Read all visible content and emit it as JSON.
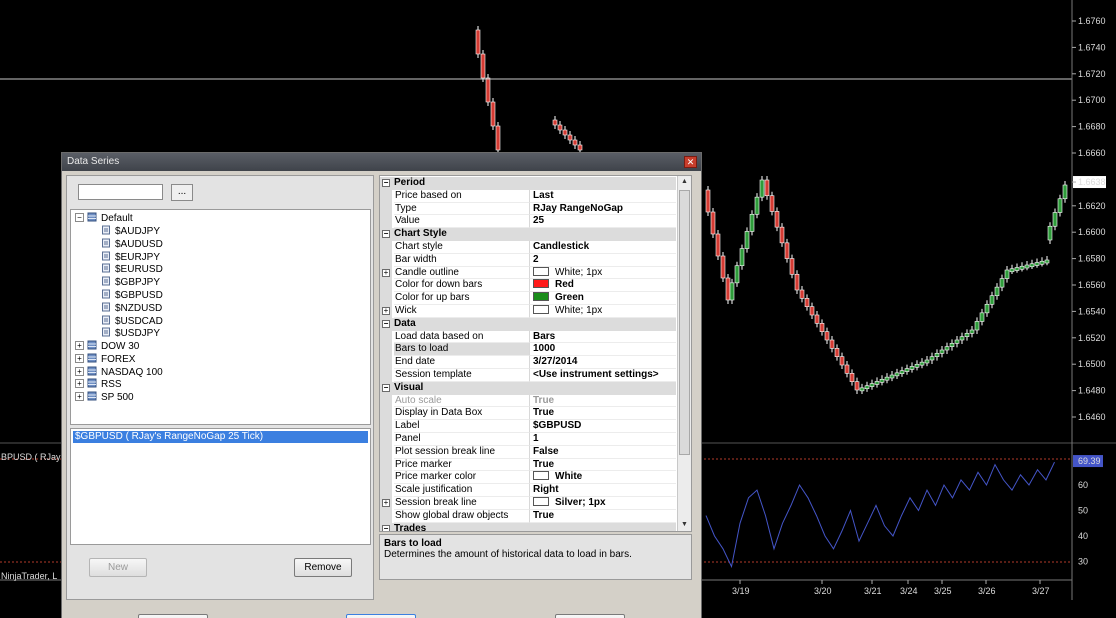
{
  "chart": {
    "price_axis": [
      "1.6760",
      "1.6740",
      "1.6720",
      "1.6700",
      "1.6680",
      "1.6660",
      "1.6638",
      "1.6620",
      "1.6600",
      "1.6580",
      "1.6560",
      "1.6540",
      "1.6520",
      "1.6500",
      "1.6480",
      "1.6460"
    ],
    "last_price": "1.6638",
    "indicator_axis": [
      "69.39",
      "60",
      "50",
      "40",
      "30"
    ],
    "indicator_value": "69.39",
    "date_labels": [
      "3/19",
      "3/20",
      "3/21",
      "3/24",
      "3/25",
      "3/26",
      "3/27"
    ],
    "series_label": "BPUSD ( RJay'",
    "copyright_label": "NinjaTrader, L",
    "colors": {
      "up": "#2e9c3a",
      "down": "#d43b33",
      "indicator": "#4455c8",
      "grid": "#c8c8c8",
      "level": "#b23a2a"
    }
  },
  "dialog": {
    "title": "Data Series",
    "close_icon": "close-icon",
    "search": {
      "value": "",
      "browse_label": "..."
    },
    "tree": {
      "root": "Default",
      "instruments": [
        "$AUDJPY",
        "$AUDUSD",
        "$EURJPY",
        "$EURUSD",
        "$GBPJPY",
        "$GBPUSD",
        "$NZDUSD",
        "$USDCAD",
        "$USDJPY"
      ],
      "lists": [
        "DOW 30",
        "FOREX",
        "NASDAQ 100",
        "RSS",
        "SP 500"
      ]
    },
    "series_list": [
      "$GBPUSD ( RJay's RangeNoGap  25 Tick)"
    ],
    "buttons": {
      "new": "New",
      "remove": "Remove"
    },
    "properties": [
      {
        "kind": "category",
        "name": "Period"
      },
      {
        "name": "Price based on",
        "value": "Last"
      },
      {
        "name": "Type",
        "value": "RJay RangeNoGap"
      },
      {
        "name": "Value",
        "value": "25"
      },
      {
        "kind": "category",
        "name": "Chart Style"
      },
      {
        "name": "Chart style",
        "value": "Candlestick"
      },
      {
        "name": "Bar width",
        "value": "2"
      },
      {
        "name": "Candle outline",
        "value": "White; 1px",
        "swatch": "#ffffff",
        "expandable": true
      },
      {
        "name": "Color for down bars",
        "value": "Red",
        "swatch": "#ff1a1a"
      },
      {
        "name": "Color for up bars",
        "value": "Green",
        "swatch": "#1a8c1a"
      },
      {
        "name": "Wick",
        "value": "White; 1px",
        "swatch": "#ffffff",
        "expandable": true
      },
      {
        "kind": "category",
        "name": "Data"
      },
      {
        "name": "Load data based on",
        "value": "Bars"
      },
      {
        "name": "Bars to load",
        "value": "1000",
        "selected": true
      },
      {
        "name": "End date",
        "value": "3/27/2014"
      },
      {
        "name": "Session template",
        "value": "<Use instrument settings>"
      },
      {
        "kind": "category",
        "name": "Visual"
      },
      {
        "name": "Auto scale",
        "value": "True",
        "disabled": true
      },
      {
        "name": "Display in Data Box",
        "value": "True"
      },
      {
        "name": "Label",
        "value": "$GBPUSD"
      },
      {
        "name": "Panel",
        "value": "1"
      },
      {
        "name": "Plot session break line",
        "value": "False"
      },
      {
        "name": "Price marker",
        "value": "True"
      },
      {
        "name": "Price marker color",
        "value": "White",
        "swatch": "#ffffff"
      },
      {
        "name": "Scale justification",
        "value": "Right"
      },
      {
        "name": "Session break line",
        "value": "Silver; 1px",
        "swatch": "#ffffff",
        "expandable": true
      },
      {
        "name": "Show global draw objects",
        "value": "True"
      },
      {
        "kind": "category",
        "name": "Trades"
      }
    ],
    "description": {
      "title": "Bars to load",
      "text": "Determines the amount of historical data to load in bars."
    }
  }
}
